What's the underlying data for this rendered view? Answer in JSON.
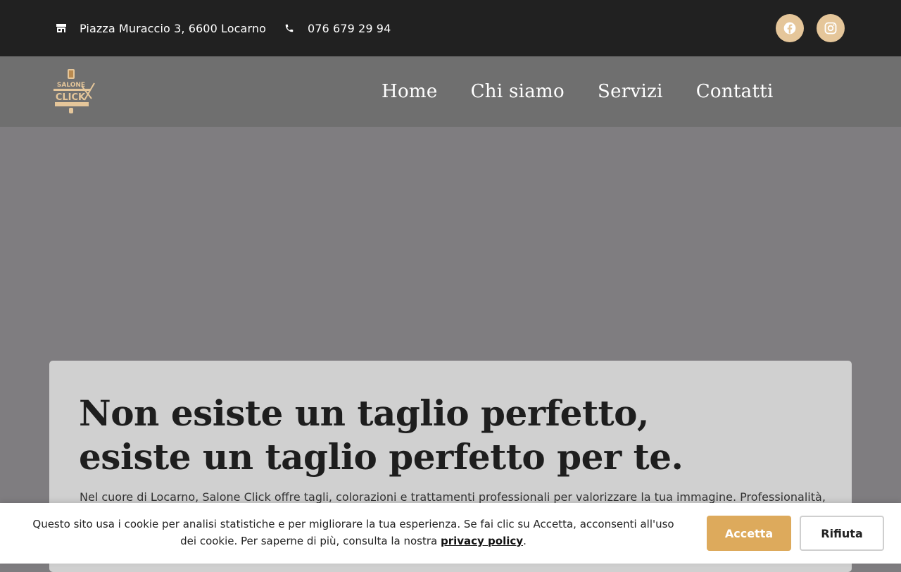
{
  "topbar": {
    "address": "Piazza Muraccio 3, 6600 Locarno",
    "address_icon": "store-icon",
    "phone": "076 679 29 94",
    "phone_icon": "phone-icon",
    "social": [
      {
        "name": "facebook-icon"
      },
      {
        "name": "instagram-icon"
      }
    ]
  },
  "logo": {
    "text_top": "SALONE",
    "text_main": "CLICK"
  },
  "nav": {
    "items": [
      "Home",
      "Chi siamo",
      "Servizi",
      "Contatti"
    ]
  },
  "hero": {
    "title_line1": "Non esiste un taglio perfetto,",
    "title_line2": "esiste un taglio perfetto per te.",
    "text": "Nel cuore di Locarno, Salone Click offre tagli, colorazioni e trattamenti professionali per valorizzare la tua immagine. Professionalità,"
  },
  "cookie": {
    "text_before": "Questo sito usa i cookie per analisi statistiche e per migliorare la tua esperienza. Se fai clic su Accetta, acconsenti all'uso dei cookie. Per saperne di più, consulta la nostra ",
    "link": "privacy policy",
    "text_after": ".",
    "accept": "Accetta",
    "reject": "Rifiuta"
  },
  "colors": {
    "topbar_bg": "#212121",
    "navbar_bg": "#6f6f6f",
    "accent": "#ddaa5c",
    "social_bg": "#e5c69a"
  }
}
